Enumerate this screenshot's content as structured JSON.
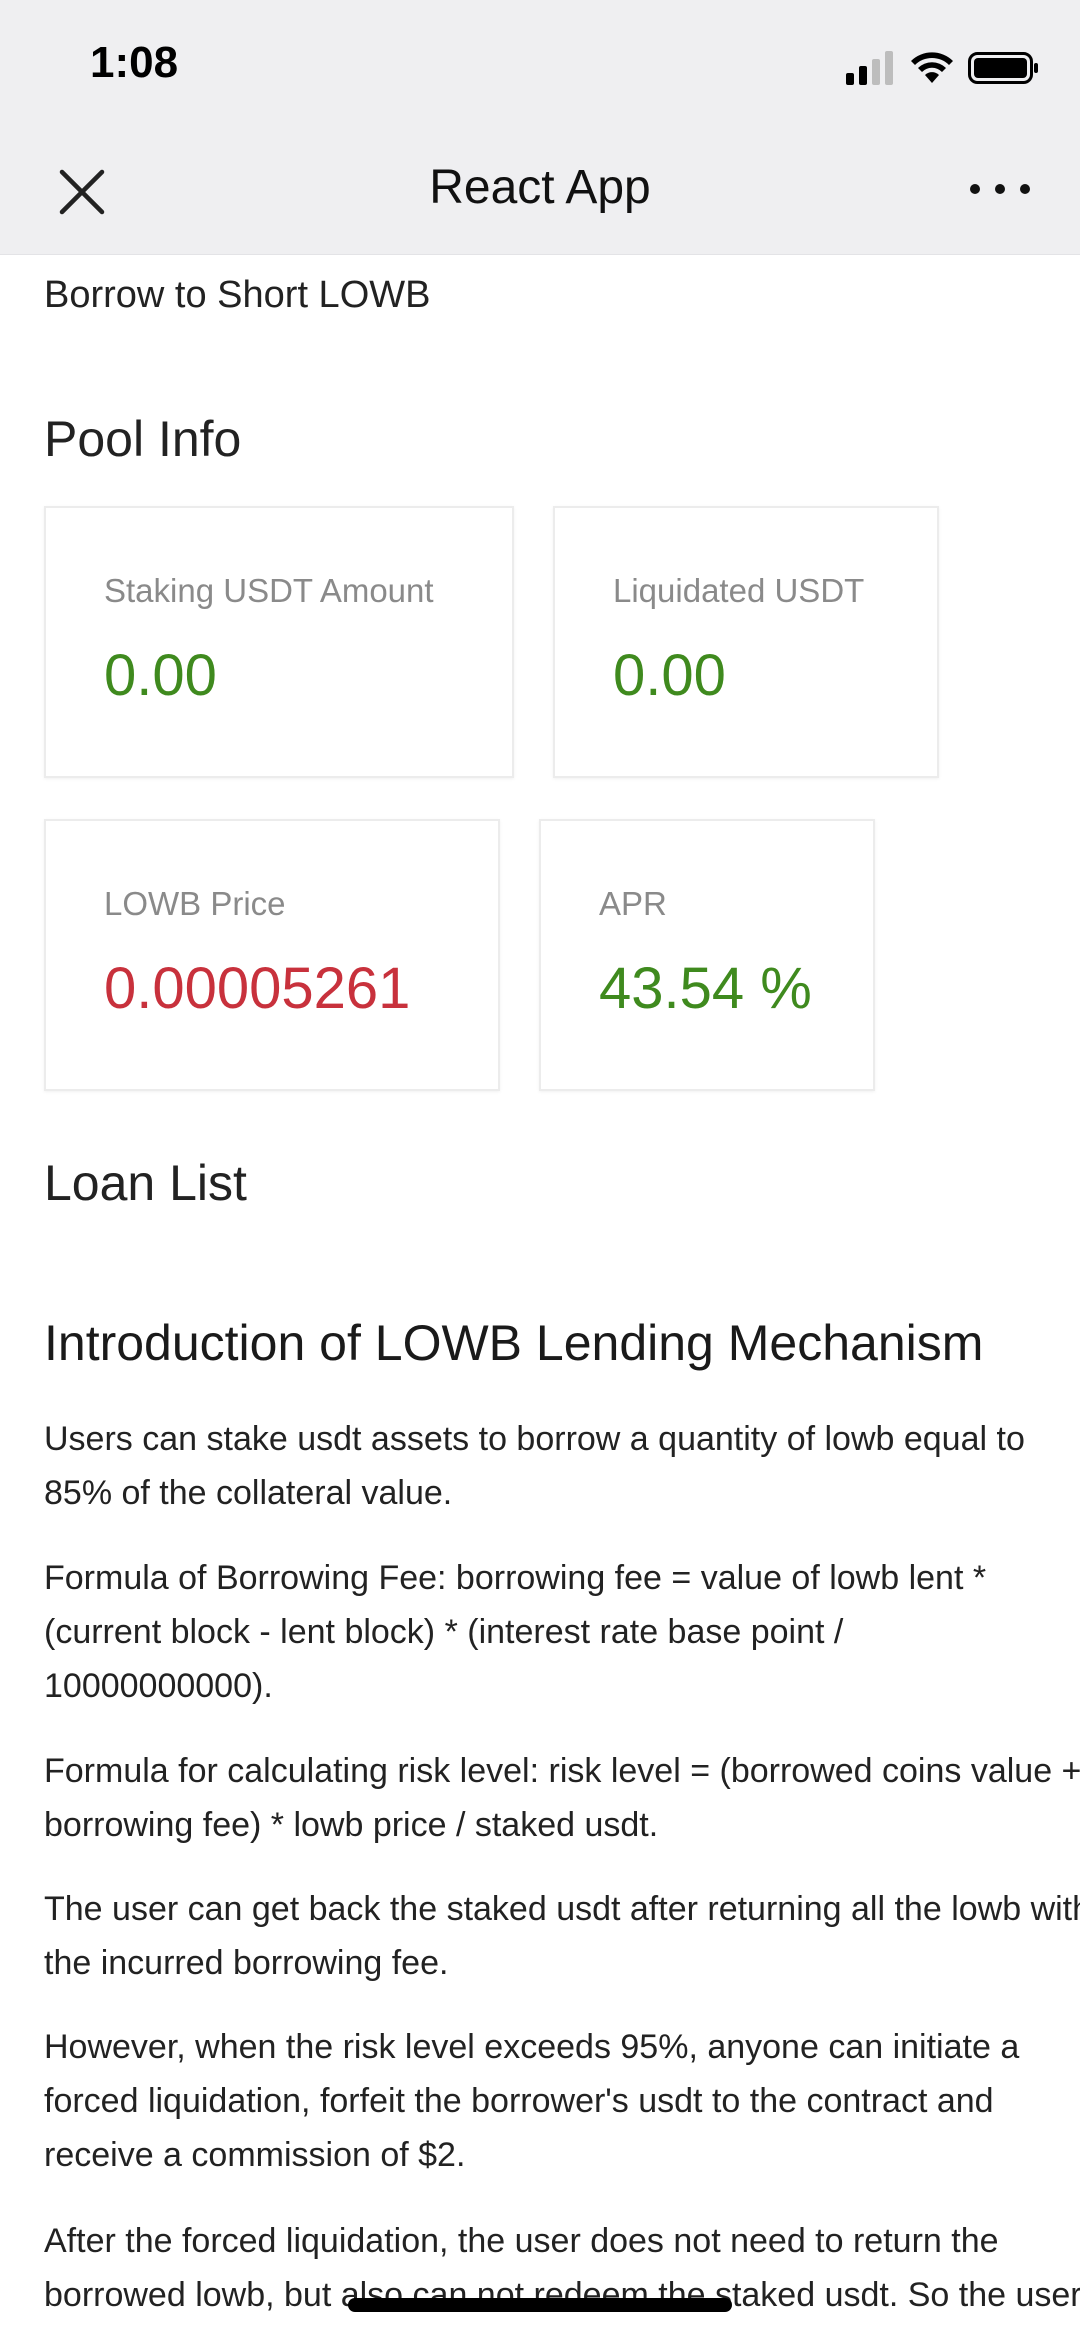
{
  "status_bar": {
    "time": "1:08"
  },
  "nav": {
    "title": "React App"
  },
  "page": {
    "subtitle": "Borrow to Short LOWB",
    "pool_info_heading": "Pool Info",
    "cards": [
      {
        "label": "Staking USDT Amount",
        "value": "0.00",
        "color": "#3f8a1e"
      },
      {
        "label": "Liquidated USDT",
        "value": "0.00",
        "color": "#3f8a1e"
      },
      {
        "label": "LOWB Price",
        "value": "0.00005261",
        "color": "#c8313c"
      },
      {
        "label": "APR",
        "value": "43.54 %",
        "color": "#3f8a1e"
      }
    ],
    "loan_list_heading": "Loan List",
    "intro_heading": "Introduction of LOWB Lending Mechanism",
    "paragraphs": [
      [
        "Users can stake usdt assets to borrow a quantity of lowb equal to",
        "85% of the collateral value."
      ],
      [
        "Formula of Borrowing Fee: borrowing fee = value of lowb lent *",
        "(current block - lent block) * (interest rate base point /",
        "10000000000)."
      ],
      [
        "Formula for calculating risk level: risk level = (borrowed coins value +",
        "borrowing fee) * lowb price / staked usdt."
      ],
      [
        "The user can get back the staked usdt after returning all the lowb with",
        "the incurred borrowing fee."
      ],
      [
        "However, when the risk level exceeds 95%, anyone can initiate a",
        "forced liquidation, forfeit the borrower's usdt to the contract and",
        "receive a commission of $2."
      ],
      [
        "After the forced liquidation, the user does not need to return the",
        "borrowed lowb, but also can not redeem the staked usdt. So the user"
      ]
    ]
  },
  "colors": {
    "accent_green": "#3f8a1e",
    "price_red": "#c8313c",
    "nav_bg": "#efeff1"
  }
}
